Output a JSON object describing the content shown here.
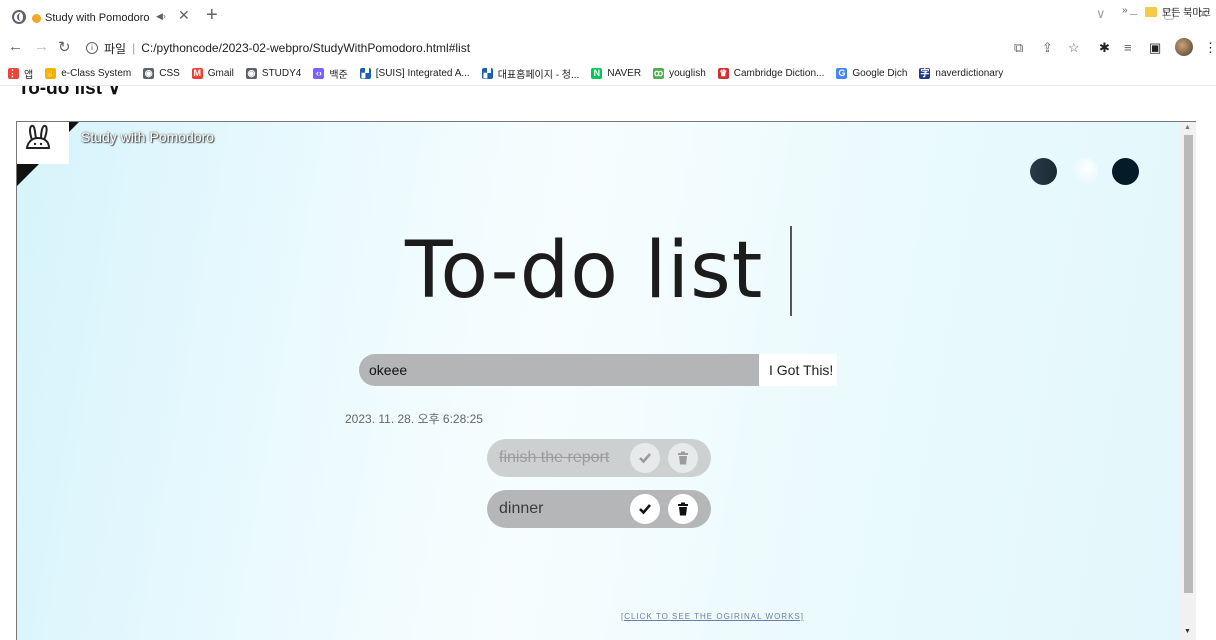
{
  "browser": {
    "tab_title": "Study with Pomodoro",
    "address": {
      "scheme_label": "파일",
      "url": "C:/pythoncode/2023-02-webpro/StudyWithPomodoro.html#list"
    },
    "bookmarks": [
      {
        "label": "앱",
        "icon": "apps-grid-icon",
        "color": "#e8453c"
      },
      {
        "label": "e-Class System",
        "icon": "hand-icon",
        "color": "#f5b400"
      },
      {
        "label": "CSS",
        "icon": "globe-icon",
        "color": "#5f6368"
      },
      {
        "label": "Gmail",
        "icon": "gmail-icon",
        "color": "#ea4335"
      },
      {
        "label": "STUDY4",
        "icon": "globe-icon",
        "color": "#5f6368"
      },
      {
        "label": "백준",
        "icon": "code-icon",
        "color": "#7b61ff"
      },
      {
        "label": "[SUIS] Integrated A...",
        "icon": "suis-icon",
        "color": "#1a5fb4"
      },
      {
        "label": "대표홈페이지 - 청...",
        "icon": "suis-icon",
        "color": "#1a5fb4"
      },
      {
        "label": "NAVER",
        "icon": "naver-icon",
        "color": "#03c75a"
      },
      {
        "label": "youglish",
        "icon": "youglish-icon",
        "color": "#4caf50"
      },
      {
        "label": "Cambridge Diction...",
        "icon": "cambridge-icon",
        "color": "#d32f2f"
      },
      {
        "label": "Google Dịch",
        "icon": "translate-icon",
        "color": "#4285f4"
      },
      {
        "label": "naverdictionary",
        "icon": "dictionary-icon",
        "color": "#1e3a8a"
      }
    ],
    "bookmarks_more": "»",
    "all_bookmarks": "모든 북마크"
  },
  "page": {
    "doc_heading": "To-do list ∨",
    "brand": "Study with Pomodoro",
    "title": "To-do list",
    "theme_colors": [
      "#2b3a47",
      "#f1fcff",
      "#031c27"
    ],
    "input": {
      "value": "okeee",
      "placeholder": ""
    },
    "add_button": "I Got This!",
    "clock": "2023. 11. 28. 오후 6:28:25",
    "todos": [
      {
        "text": "finish the report",
        "done": true
      },
      {
        "text": "dinner",
        "done": false
      }
    ],
    "credit_link": "[CLICK TO SEE THE OGIRINAL WORKS]"
  }
}
